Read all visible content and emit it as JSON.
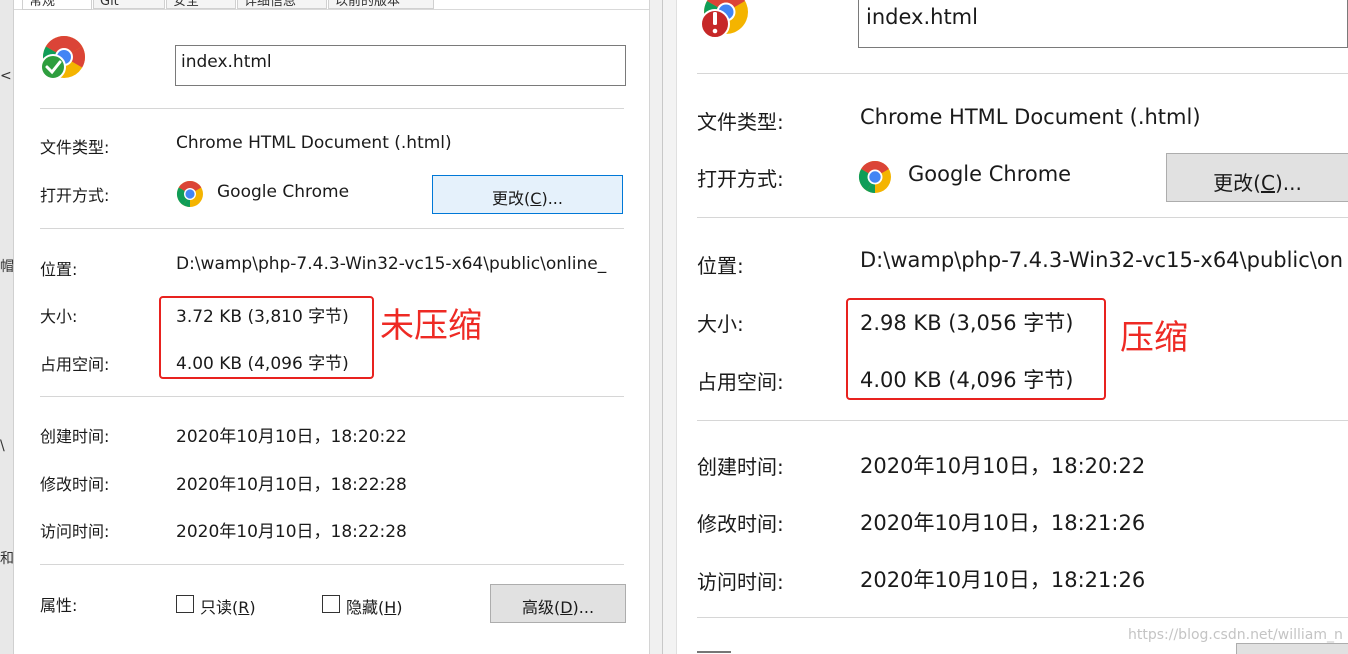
{
  "left": {
    "tabs": [
      "常规",
      "Git",
      "安全",
      "详细信息",
      "以前的版本"
    ],
    "file_name": "index.html",
    "labels": {
      "file_type": "文件类型:",
      "opens_with": "打开方式:",
      "location": "位置:",
      "size": "大小:",
      "size_on_disk": "占用空间:",
      "created": "创建时间:",
      "modified": "修改时间:",
      "accessed": "访问时间:",
      "attributes": "属性:"
    },
    "values": {
      "file_type": "Chrome HTML Document (.html)",
      "opens_with": "Google Chrome",
      "location": "D:\\wamp\\php-7.4.3-Win32-vc15-x64\\public\\online_",
      "size": "3.72 KB (3,810 字节)",
      "size_on_disk": "4.00 KB (4,096 字节)",
      "created": "2020年10月10日，18:20:22",
      "modified": "2020年10月10日，18:22:28",
      "accessed": "2020年10月10日，18:22:28"
    },
    "change_button": {
      "text": "更改(",
      "key": "C",
      "tail": ")..."
    },
    "readonly": {
      "text": "只读(",
      "key": "R",
      "tail": ")"
    },
    "hidden": {
      "text": "隐藏(",
      "key": "H",
      "tail": ")"
    },
    "advanced_button": {
      "text": "高级(",
      "key": "D",
      "tail": ")..."
    },
    "annotation": "未压缩",
    "edge_glyphs": [
      "<",
      "帽",
      "\\",
      "和"
    ]
  },
  "right": {
    "file_name": "index.html",
    "labels": {
      "file_type": "文件类型:",
      "opens_with": "打开方式:",
      "location": "位置:",
      "size": "大小:",
      "size_on_disk": "占用空间:",
      "created": "创建时间:",
      "modified": "修改时间:",
      "accessed": "访问时间:"
    },
    "values": {
      "file_type": "Chrome HTML Document (.html)",
      "opens_with": "Google Chrome",
      "location": "D:\\wamp\\php-7.4.3-Win32-vc15-x64\\public\\on",
      "size": "2.98 KB (3,056 字节)",
      "size_on_disk": "4.00 KB (4,096 字节)",
      "created": "2020年10月10日，18:20:22",
      "modified": "2020年10月10日，18:21:26",
      "accessed": "2020年10月10日，18:21:26"
    },
    "change_button": {
      "text": "更改(",
      "key": "C",
      "tail": ")..."
    },
    "annotation": "压缩",
    "watermark": "https://blog.csdn.net/william_n"
  },
  "colors": {
    "annotation_red": "#e8221f",
    "focus_blue": "#0078d7",
    "chrome_red": "#db4437",
    "chrome_yellow": "#f4b400",
    "chrome_green": "#0f9d58",
    "chrome_blue": "#4285f4"
  }
}
